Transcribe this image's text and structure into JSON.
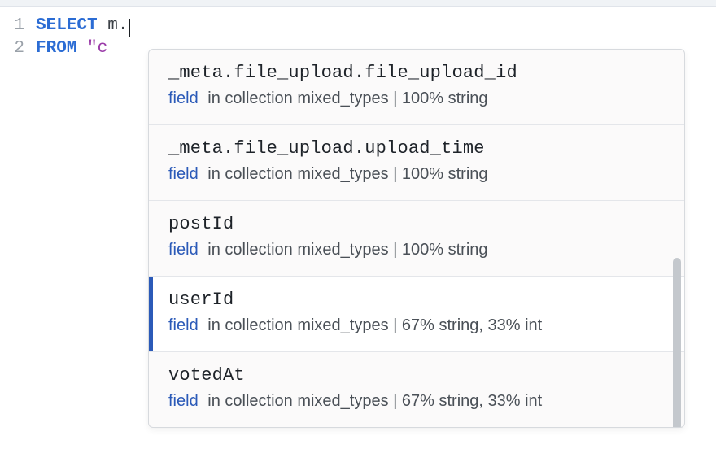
{
  "editor": {
    "lines": [
      {
        "number": "1",
        "segments": [
          {
            "cls": "kw",
            "text": "SELECT"
          },
          {
            "cls": "sql-text",
            "text": " m."
          }
        ],
        "cursor": true
      },
      {
        "number": "2",
        "segments": [
          {
            "cls": "kw",
            "text": "FROM"
          },
          {
            "cls": "sql-text",
            "text": " "
          },
          {
            "cls": "quoted",
            "text": "\"c"
          }
        ],
        "cursor": false
      }
    ]
  },
  "autocomplete": {
    "selectedIndex": 3,
    "items": [
      {
        "name": "_meta.file_upload.file_upload_id",
        "kind": "field",
        "desc": "in collection mixed_types | 100% string"
      },
      {
        "name": "_meta.file_upload.upload_time",
        "kind": "field",
        "desc": "in collection mixed_types | 100% string"
      },
      {
        "name": "postId",
        "kind": "field",
        "desc": "in collection mixed_types | 100% string"
      },
      {
        "name": "userId",
        "kind": "field",
        "desc": "in collection mixed_types | 67% string, 33% int"
      },
      {
        "name": "votedAt",
        "kind": "field",
        "desc": "in collection mixed_types | 67% string, 33% int"
      }
    ]
  }
}
